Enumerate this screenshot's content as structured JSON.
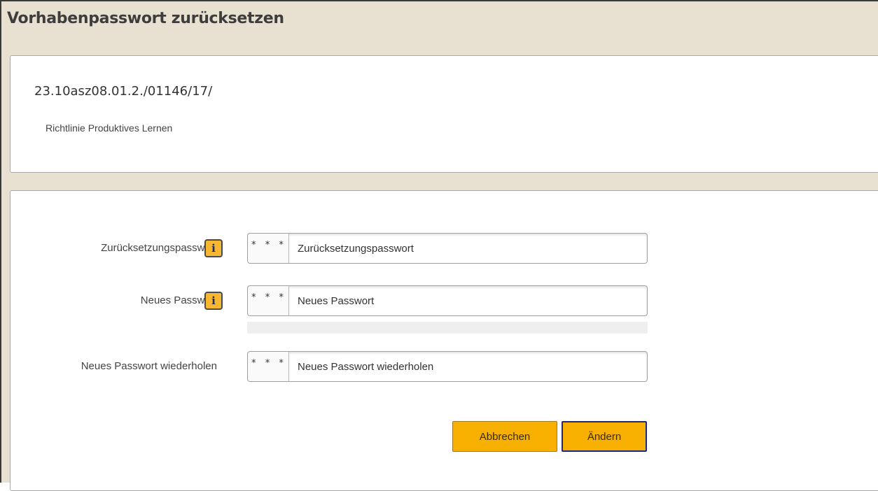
{
  "dialog": {
    "title": "Vorhabenpasswort zurücksetzen"
  },
  "project": {
    "id": "23.10asz08.01.2./01146/17/",
    "name": "Richtlinie Produktives Lernen"
  },
  "form": {
    "fields": [
      {
        "label": "Zurücksetzungspasswort",
        "prefix": "* * *",
        "placeholder": "Zurücksetzungspasswort",
        "value": "",
        "has_info": true,
        "info_icon": "info-icon",
        "info_glyph": "i"
      },
      {
        "label": "Neues Passwort",
        "prefix": "* * *",
        "placeholder": "Neues Passwort",
        "value": "",
        "has_info": true,
        "info_icon": "info-icon",
        "info_glyph": "i"
      },
      {
        "label": "Neues Passwort wiederholen",
        "prefix": "* * *",
        "placeholder": "Neues Passwort wiederholen",
        "value": "",
        "has_info": false
      }
    ],
    "strength_level": 0
  },
  "actions": {
    "cancel_label": "Abbrechen",
    "submit_label": "Ändern"
  },
  "colors": {
    "header_bg": "#e8e1d1",
    "button_bg": "#f7b000",
    "info_bg": "#f7b731",
    "submit_border": "#1e2a78"
  }
}
